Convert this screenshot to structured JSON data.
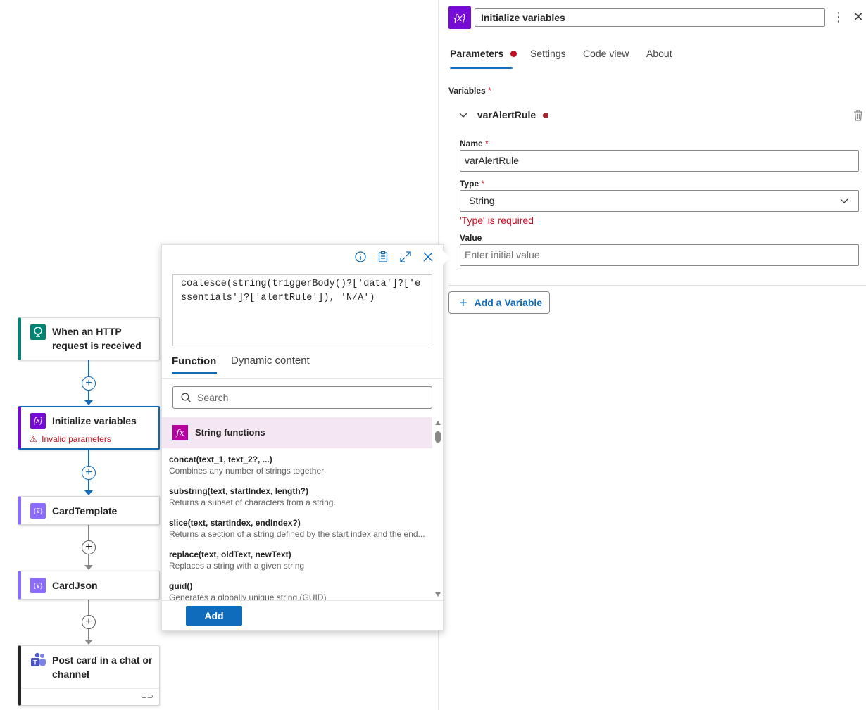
{
  "flow": {
    "nodes": [
      {
        "title": "When an HTTP request is received",
        "color": "#008575"
      },
      {
        "title": "Initialize variables",
        "warning": "Invalid parameters",
        "color": "#770bd6"
      },
      {
        "title": "CardTemplate",
        "color": "#8c6cff"
      },
      {
        "title": "CardJson",
        "color": "#8c6cff"
      },
      {
        "title": "Post card in a chat or channel",
        "color": "#4b53bc"
      }
    ]
  },
  "panel": {
    "title": "Initialize variables",
    "tabs": [
      "Parameters",
      "Settings",
      "Code view",
      "About"
    ],
    "variables_label": "Variables",
    "required_mark": "*",
    "variable": {
      "name_header": "varAlertRule",
      "name_label": "Name",
      "name_value": "varAlertRule",
      "type_label": "Type",
      "type_value": "String",
      "type_error": "'Type' is required",
      "value_label": "Value",
      "value_placeholder": "Enter initial value"
    },
    "add_variable_label": "Add a Variable"
  },
  "expression_popup": {
    "expression": "coalesce(string(triggerBody()?['data']?['essentials']?['alertRule']), 'N/A')",
    "tabs": [
      "Function",
      "Dynamic content"
    ],
    "search_placeholder": "Search",
    "category": "String functions",
    "functions": [
      {
        "name": "concat(text_1, text_2?, ...)",
        "desc": "Combines any number of strings together"
      },
      {
        "name": "substring(text, startIndex, length?)",
        "desc": "Returns a subset of characters from a string."
      },
      {
        "name": "slice(text, startIndex, endIndex?)",
        "desc": "Returns a section of a string defined by the start index and the end..."
      },
      {
        "name": "replace(text, oldText, newText)",
        "desc": "Replaces a string with a given string"
      },
      {
        "name": "guid()",
        "desc": "Generates a globally unique string (GUID)"
      }
    ],
    "add_label": "Add"
  },
  "colors": {
    "accent": "#0f6cbd",
    "error": "#c50f1f",
    "category_bg": "#f5e6f3",
    "fx_icon": "#b4009e"
  }
}
